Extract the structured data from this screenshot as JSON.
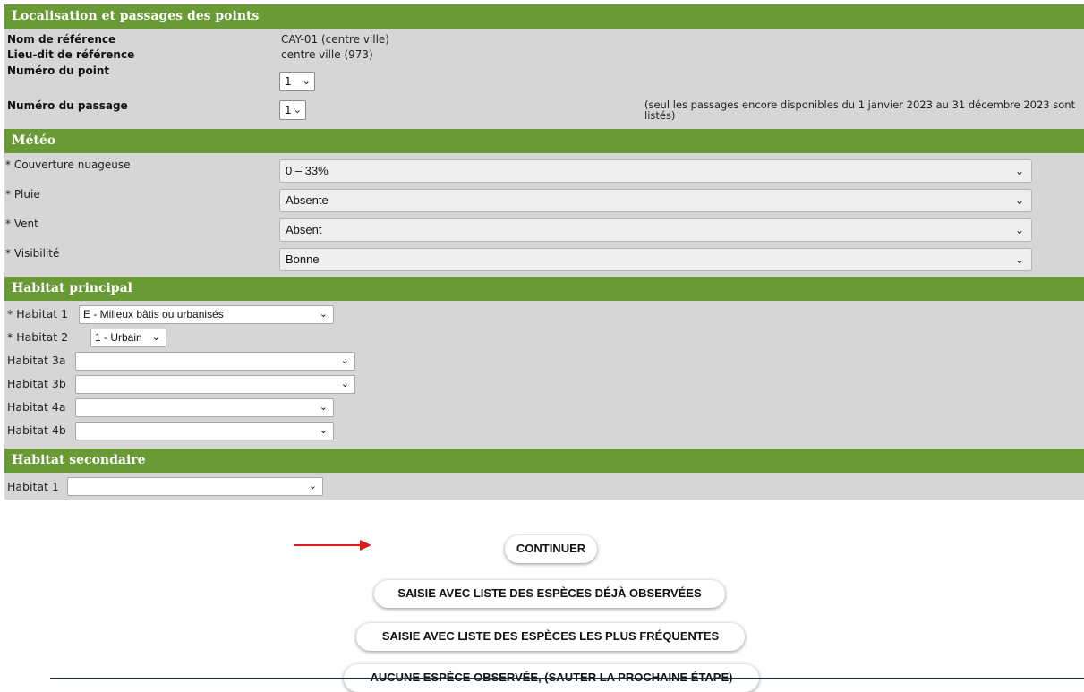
{
  "localisation": {
    "title": "Localisation et passages des points",
    "nom_label": "Nom de référence",
    "nom_value": "CAY-01 (centre ville)",
    "lieu_label": "Lieu-dit de référence",
    "lieu_value": "centre ville (973)",
    "point_label": "Numéro du point",
    "point_value": "1",
    "passage_label": "Numéro du passage",
    "passage_value": "1",
    "passage_note": "(seul les passages encore disponibles du 1 janvier 2023 au 31 décembre 2023 sont listés)"
  },
  "meteo": {
    "title": "Météo",
    "fields": [
      {
        "label": "* Couverture nuageuse",
        "value": "0 – 33%"
      },
      {
        "label": "* Pluie",
        "value": "Absente"
      },
      {
        "label": "* Vent",
        "value": "Absent"
      },
      {
        "label": "* Visibilité",
        "value": "Bonne"
      }
    ]
  },
  "habitat_principal": {
    "title": "Habitat principal",
    "fields": [
      {
        "label": "* Habitat 1",
        "value": "E - Milieux bâtis ou urbanisés"
      },
      {
        "label": "* Habitat 2",
        "value": "1 - Urbain"
      },
      {
        "label": "Habitat 3a",
        "value": ""
      },
      {
        "label": "Habitat 3b",
        "value": ""
      },
      {
        "label": "Habitat 4a",
        "value": ""
      },
      {
        "label": "Habitat 4b",
        "value": ""
      }
    ]
  },
  "habitat_secondaire": {
    "title": "Habitat secondaire",
    "fields": [
      {
        "label": "Habitat 1",
        "value": ""
      }
    ]
  },
  "buttons": {
    "continuer": "CONTINUER",
    "deja_observees": "SAISIE AVEC LISTE DES ESPÈCES DÉJÀ OBSERVÉES",
    "plus_frequentes": "SAISIE AVEC LISTE DES ESPÈCES LES PLUS FRÉQUENTES",
    "aucune": "AUCUNE ESPÈCE OBSERVÉE, (SAUTER LA PROCHAINE ÉTAPE)"
  },
  "icons": {
    "dropdown": "chevron-down-icon",
    "arrow": "red-arrow-right-icon"
  },
  "colors": {
    "header_green": "#6a9a35",
    "panel_grey": "#d6d6d6",
    "arrow_red": "#e0191b"
  }
}
